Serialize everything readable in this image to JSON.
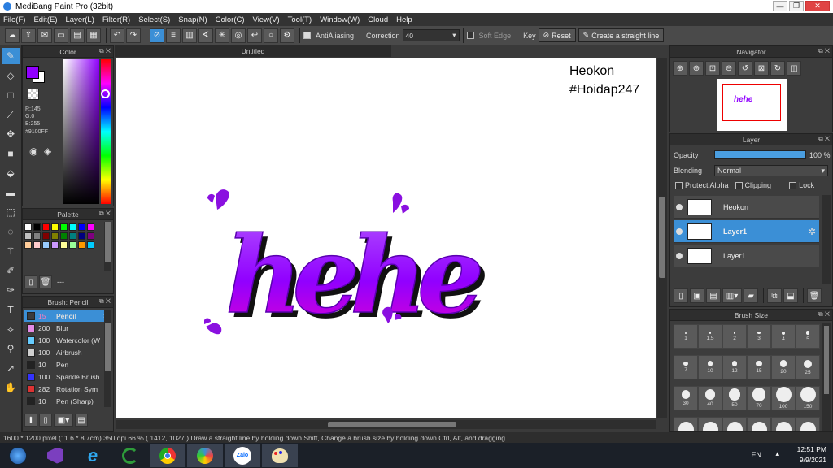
{
  "window": {
    "title": "MediBang Paint Pro (32bit)"
  },
  "menu": [
    "File(F)",
    "Edit(E)",
    "Layer(L)",
    "Filter(R)",
    "Select(S)",
    "Snap(N)",
    "Color(C)",
    "View(V)",
    "Tool(T)",
    "Window(W)",
    "Cloud",
    "Help"
  ],
  "toolbar": {
    "antialiasing_label": "AntiAliasing",
    "correction_label": "Correction",
    "correction_value": "40",
    "soft_edge_label": "Soft Edge",
    "key_label": "Key",
    "reset_label": "Reset",
    "straight_line_label": "Create a straight line"
  },
  "document": {
    "tab_title": "Untitled"
  },
  "canvas": {
    "watermark_line1": "Heokon",
    "watermark_line2": "#Hoidap247",
    "art_text": "hehe",
    "art_color": "#9100FF"
  },
  "color_panel": {
    "title": "Color",
    "r": "R:145",
    "g": "G:0",
    "b": "B:255",
    "hex": "#9100FF",
    "foreground": "#9100FF"
  },
  "palette_panel": {
    "title": "Palette",
    "colors": [
      "#ffffff",
      "#000000",
      "#ff0000",
      "#ffff00",
      "#00ff00",
      "#00ffff",
      "#0000ff",
      "#ff00ff",
      "#c0c0c0",
      "#808080",
      "#800000",
      "#808000",
      "#008000",
      "#008080",
      "#000080",
      "#800080",
      "#ffcc99",
      "#ffcccc",
      "#99ccff",
      "#cc99ff",
      "#ffff99",
      "#99ff99",
      "#ff9900",
      "#00ccff"
    ],
    "status": "---"
  },
  "brush_panel": {
    "title": "Brush: Pencil",
    "items": [
      {
        "size": "15",
        "name": "Pencil",
        "color": "#3b3b3b",
        "selected": true
      },
      {
        "size": "200",
        "name": "Blur",
        "color": "#e58ae6",
        "selected": false
      },
      {
        "size": "100",
        "name": "Watercolor (W",
        "color": "#66ccff",
        "selected": false
      },
      {
        "size": "100",
        "name": "Airbrush",
        "color": "#d0d0d0",
        "selected": false
      },
      {
        "size": "10",
        "name": "Pen",
        "color": "#222222",
        "selected": false
      },
      {
        "size": "100",
        "name": "Sparkle Brush",
        "color": "#3333ff",
        "selected": false
      },
      {
        "size": "282",
        "name": "Rotation Sym",
        "color": "#dd3333",
        "selected": false
      },
      {
        "size": "10",
        "name": "Pen (Sharp)",
        "color": "#222222",
        "selected": false
      }
    ]
  },
  "navigator": {
    "title": "Navigator"
  },
  "layer_panel": {
    "title": "Layer",
    "opacity_label": "Opacity",
    "opacity_value": "100 %",
    "opacity_fraction": 1.0,
    "blending_label": "Blending",
    "blending_value": "Normal",
    "protect_alpha_label": "Protect Alpha",
    "clipping_label": "Clipping",
    "lock_label": "Lock",
    "layers": [
      {
        "name": "Heokon",
        "selected": false
      },
      {
        "name": "Layer1",
        "selected": true
      },
      {
        "name": "Layer1",
        "selected": false
      }
    ]
  },
  "brush_size": {
    "title": "Brush Size",
    "sizes": [
      "1",
      "1.5",
      "2",
      "3",
      "4",
      "5",
      "7",
      "10",
      "12",
      "15",
      "20",
      "25",
      "30",
      "40",
      "50",
      "70",
      "100",
      "150"
    ]
  },
  "status": {
    "text": "1600 * 1200 pixel  (11.6 * 8.7cm)  350 dpi  66 %  ( 1412, 1027 )  Draw a straight line by holding down Shift, Change a brush size by holding down Ctrl, Alt, and dragging"
  },
  "taskbar": {
    "language": "EN",
    "time": "12:51 PM",
    "date": "9/9/2021",
    "zalo_label": "Zalo",
    "apps": [
      "start-icon",
      "visual-studio-icon",
      "internet-explorer-icon",
      "ccleaner-icon",
      "chrome-icon",
      "medibang-icon",
      "zalo-icon",
      "paint-icon"
    ]
  }
}
